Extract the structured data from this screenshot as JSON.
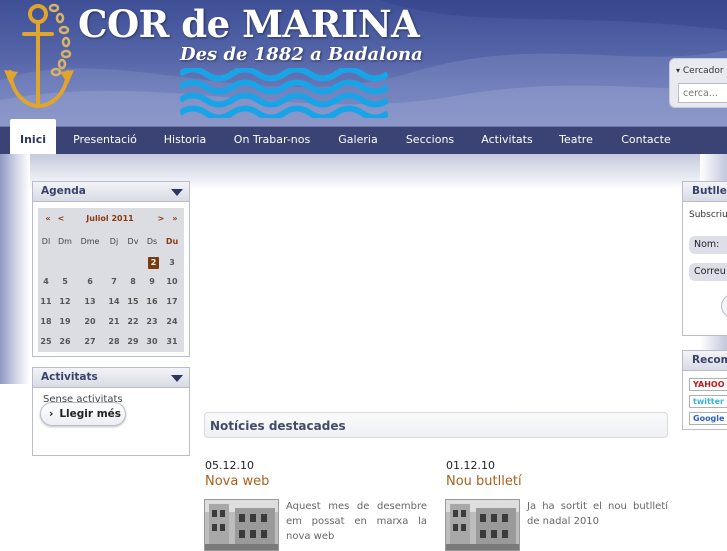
{
  "header": {
    "title": "COR de MARINA",
    "subtitle": "Des de 1882 a Badalona"
  },
  "search": {
    "label": "Cercador",
    "placeholder": "cerca..."
  },
  "nav": {
    "items": [
      {
        "label": "Inici",
        "active": true
      },
      {
        "label": "Presentació",
        "active": false
      },
      {
        "label": "Historia",
        "active": false
      },
      {
        "label": "On Trabar-nos",
        "active": false
      },
      {
        "label": "Galeria",
        "active": false
      },
      {
        "label": "Seccions",
        "active": false
      },
      {
        "label": "Activitats",
        "active": false
      },
      {
        "label": "Teatre",
        "active": false
      },
      {
        "label": "Contacte",
        "active": false
      }
    ]
  },
  "agenda": {
    "title": "Agenda",
    "nav_prev_year": "«",
    "nav_prev_month": "<",
    "month": "Juliol 2011",
    "nav_next_month": ">",
    "nav_next_year": "»",
    "weekdays": [
      "Dl",
      "Dm",
      "Dme",
      "Dj",
      "Dv",
      "Ds",
      "Du"
    ],
    "weeks": [
      [
        "",
        "",
        "",
        "",
        "",
        "2",
        "3"
      ],
      [
        "4",
        "5",
        "6",
        "7",
        "8",
        "9",
        "10"
      ],
      [
        "11",
        "12",
        "13",
        "14",
        "15",
        "16",
        "17"
      ],
      [
        "18",
        "19",
        "20",
        "21",
        "22",
        "23",
        "24"
      ],
      [
        "25",
        "26",
        "27",
        "28",
        "29",
        "30",
        "31"
      ]
    ],
    "highlight_day": "2"
  },
  "activities": {
    "title": "Activitats",
    "empty_text": "Sense activitats",
    "more_button": "Llegir més",
    "more_icon": "›"
  },
  "featured": {
    "title": "Notícies destacades"
  },
  "news": [
    {
      "date": "05.12.10",
      "title": "Nova web",
      "text": "Aquest mes de desembre em possat en marxa la nova web"
    },
    {
      "date": "01.12.10",
      "title": "Nou butlletí",
      "text": "Ja ha sortit el nou butlletí de nadal 2010"
    }
  ],
  "newsletter": {
    "title": "Butlletí",
    "subscribe_label": "Subscriure",
    "name_label": "Nom:",
    "email_label": "Correu"
  },
  "recommend": {
    "title": "Recomanar",
    "logos": [
      "YAHOO",
      "twitter",
      "Google"
    ]
  },
  "colors": {
    "header_blue": "#4a5a9f",
    "nav_bg": "#3a4373",
    "accent_brown": "#a8611a",
    "today_bg": "#7a3b0e"
  }
}
